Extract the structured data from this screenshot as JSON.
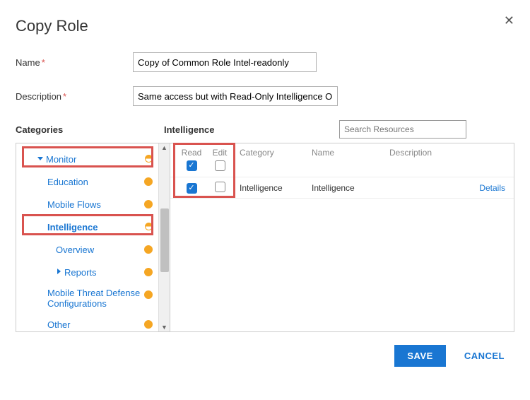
{
  "dialog": {
    "title": "Copy Role",
    "close_glyph": "✕"
  },
  "form": {
    "name_label": "Name",
    "name_value": "Copy of Common Role Intel-readonly",
    "desc_label": "Description",
    "desc_value": "Same access but with Read-Only Intelligence Opt-In",
    "required_mark": "*"
  },
  "sections": {
    "categories_label": "Categories",
    "selected_label": "Intelligence",
    "search_placeholder": "Search Resources"
  },
  "categories": [
    {
      "id": "monitor",
      "label": "Monitor",
      "indent": 1,
      "caret": "down",
      "dot": "half"
    },
    {
      "id": "education",
      "label": "Education",
      "indent": 2,
      "caret": "",
      "dot": "full"
    },
    {
      "id": "mflows",
      "label": "Mobile Flows",
      "indent": 2,
      "caret": "",
      "dot": "full"
    },
    {
      "id": "intel",
      "label": "Intelligence",
      "indent": 2,
      "caret": "",
      "dot": "half",
      "selected": true
    },
    {
      "id": "overview",
      "label": "Overview",
      "indent": 3,
      "caret": "",
      "dot": "full"
    },
    {
      "id": "reports",
      "label": "Reports",
      "indent": 3,
      "caret": "right",
      "dot": "full"
    },
    {
      "id": "mtd",
      "label": "Mobile Threat Defense Configurations",
      "indent": 2,
      "caret": "",
      "dot": "full",
      "tall": true
    },
    {
      "id": "other",
      "label": "Other",
      "indent": 2,
      "caret": "",
      "dot": "full"
    }
  ],
  "grid": {
    "head": {
      "read": "Read",
      "edit": "Edit",
      "category": "Category",
      "name": "Name",
      "description": "Description"
    },
    "header_row": {
      "read_checked": true,
      "edit_checked": false
    },
    "rows": [
      {
        "read_checked": true,
        "edit_checked": false,
        "category": "Intelligence",
        "name": "Intelligence",
        "description": "",
        "details_label": "Details"
      }
    ]
  },
  "footer": {
    "save_label": "SAVE",
    "cancel_label": "CANCEL"
  },
  "scrollbar": {
    "up": "▲",
    "down": "▼"
  }
}
